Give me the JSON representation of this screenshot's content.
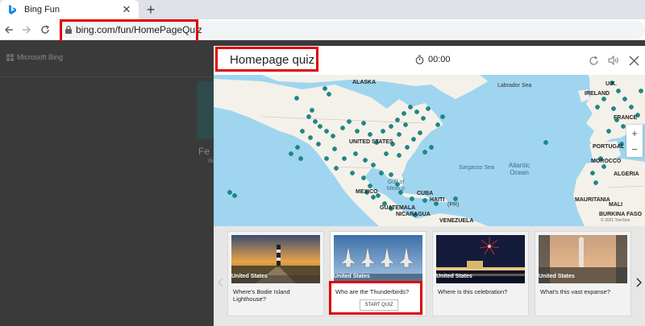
{
  "browser": {
    "tab_title": "Bing Fun",
    "url": "bing.com/fun/HomePageQuiz"
  },
  "background_page": {
    "brand": "Microsoft Bing",
    "heading_fragment": "Fe",
    "side_fragment": "ific"
  },
  "modal": {
    "title": "Homepage quiz",
    "timer": "00:00"
  },
  "map": {
    "labels": {
      "alaska": "ALASKA",
      "labrador_sea": "Labrador Sea",
      "united_states": "UNITED STATES",
      "gulf_of_mexico": "Gulf of Mexico",
      "sargasso_sea": "Sargasso Sea",
      "atlantic_ocean": "Atlantic Ocean",
      "mexico": "MEXICO",
      "cuba": "CUBA",
      "haiti": "HAITI",
      "guatemala": "GUATEMALA",
      "nicaragua": "NICARAGUA",
      "venezuela": "VENEZUELA",
      "ireland": "IRELAND",
      "france": "FRANCE",
      "portugal": "PORTUGAL",
      "morocco": "MOROCCO",
      "algeria": "ALGERIA",
      "mauritania": "MAURITANIA",
      "mali": "MALI",
      "burkina_faso": "BURKINA FASO",
      "u_k": "U.K.",
      "pr": "(PR)"
    },
    "copyright": "© 2021 TomTom"
  },
  "cards": [
    {
      "country": "United States",
      "question": "Where's Bodie Island Lighthouse?"
    },
    {
      "country": "United States",
      "question": "Who are the Thunderbirds?",
      "button": "START QUIZ"
    },
    {
      "country": "United States",
      "question": "Where is this celebration?"
    },
    {
      "country": "United States",
      "question": "What's this vast expanse?"
    }
  ],
  "colors": {
    "highlight": "#e00000",
    "marker": "#1a8a86",
    "ocean": "#9fd5ef",
    "land": "#f4f1ea"
  }
}
